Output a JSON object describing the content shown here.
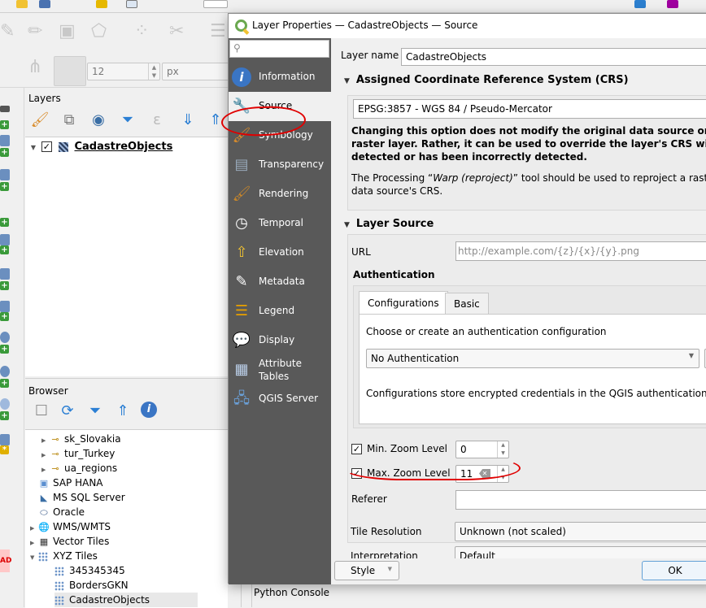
{
  "main_window": {
    "snap_tolerance": "12",
    "snap_units": "px",
    "layers_panel": {
      "title": "Layers",
      "tree": [
        {
          "name": "CadastreObjects",
          "checked": true,
          "expanded": true
        }
      ]
    },
    "browser_panel": {
      "title": "Browser",
      "items": [
        {
          "label": "sk_Slovakia",
          "icon": "connection-icon",
          "level": 2,
          "expandable": true
        },
        {
          "label": "tur_Turkey",
          "icon": "connection-icon",
          "level": 2,
          "expandable": true
        },
        {
          "label": "ua_regions",
          "icon": "connection-icon",
          "level": 2,
          "expandable": true
        },
        {
          "label": "SAP HANA",
          "icon": "sap-hana-icon",
          "level": 1,
          "expandable": false
        },
        {
          "label": "MS SQL Server",
          "icon": "mssql-icon",
          "level": 1,
          "expandable": false
        },
        {
          "label": "Oracle",
          "icon": "oracle-icon",
          "level": 1,
          "expandable": false
        },
        {
          "label": "WMS/WMTS",
          "icon": "globe-icon",
          "level": 1,
          "expandable": true
        },
        {
          "label": "Vector Tiles",
          "icon": "vector-tiles-icon",
          "level": 1,
          "expandable": true
        },
        {
          "label": "XYZ Tiles",
          "icon": "xyz-tiles-icon",
          "level": 1,
          "expandable": true,
          "expanded": true
        },
        {
          "label": "345345345",
          "icon": "xyz-tiles-icon",
          "level": 2,
          "expandable": false
        },
        {
          "label": "BordersGKN",
          "icon": "xyz-tiles-icon",
          "level": 2,
          "expandable": false
        },
        {
          "label": "CadastreObjects",
          "icon": "xyz-tiles-icon",
          "level": 2,
          "expandable": false,
          "selected": true
        }
      ]
    },
    "python_console_label": "Python Console",
    "left_strip_badge": "AD"
  },
  "dialog": {
    "title": "Layer Properties — CadastreObjects — Source",
    "sidebar": {
      "search_placeholder": "",
      "items": [
        {
          "label": "Information",
          "icon": "information-icon"
        },
        {
          "label": "Source",
          "icon": "source-wrench-icon",
          "active": true
        },
        {
          "label": "Symbology",
          "icon": "symbology-brush-icon"
        },
        {
          "label": "Transparency",
          "icon": "transparency-icon"
        },
        {
          "label": "Rendering",
          "icon": "rendering-brush-icon"
        },
        {
          "label": "Temporal",
          "icon": "clock-icon"
        },
        {
          "label": "Elevation",
          "icon": "elevation-icon"
        },
        {
          "label": "Metadata",
          "icon": "metadata-icon"
        },
        {
          "label": "Legend",
          "icon": "legend-icon"
        },
        {
          "label": "Display",
          "icon": "speech-bubble-icon"
        },
        {
          "label": "Attribute Tables",
          "icon": "attribute-table-icon"
        },
        {
          "label": "QGIS Server",
          "icon": "server-icon"
        }
      ]
    },
    "layer_name_label": "Layer name",
    "layer_name_value": "CadastreObjects",
    "crs_section": {
      "title": "Assigned Coordinate Reference System (CRS)",
      "selected": "EPSG:3857 - WGS 84 / Pseudo-Mercator",
      "warning_lines": [
        "Changing this option does not modify the original data source or pe",
        "raster layer. Rather, it can be used to override the layer's CRS with",
        "detected or has been incorrectly detected."
      ],
      "note_prefix": "The Processing “",
      "note_italic": "Warp (reproject)",
      "note_suffix": "” tool should be used to reproject a raster",
      "note_line2": "data source's CRS."
    },
    "source_section": {
      "title": "Layer Source",
      "url_label": "URL",
      "url_placeholder": "http://example.com/{z}/{x}/{y}.png",
      "authentication": {
        "title": "Authentication",
        "tabs": [
          {
            "label": "Configurations",
            "active": true
          },
          {
            "label": "Basic",
            "active": false
          }
        ],
        "choose_label": "Choose or create an authentication configuration",
        "selected_config": "No Authentication",
        "info_text": "Configurations store encrypted credentials in the QGIS authentication data"
      },
      "min_zoom": {
        "label": "Min. Zoom Level",
        "checked": true,
        "value": "0"
      },
      "max_zoom": {
        "label": "Max. Zoom Level",
        "checked": true,
        "value": "11"
      },
      "referer": {
        "label": "Referer",
        "value": ""
      },
      "tile_resolution": {
        "label": "Tile Resolution",
        "value": "Unknown (not scaled)"
      },
      "interpretation": {
        "label": "Interpretation",
        "value": "Default"
      }
    },
    "buttons": {
      "style": "Style",
      "ok": "OK"
    },
    "annotation_color": "#e00000"
  }
}
